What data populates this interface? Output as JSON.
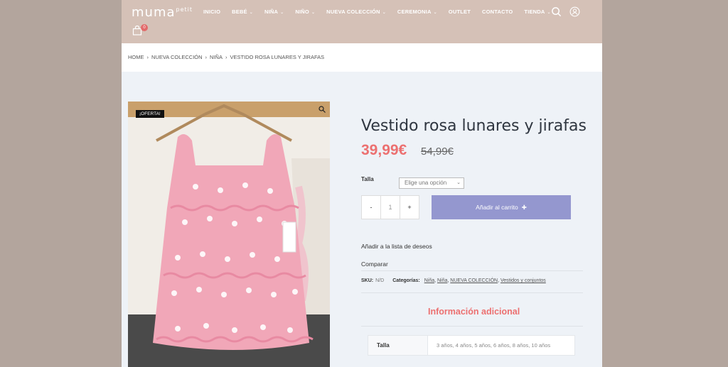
{
  "header": {
    "logo_main": "muma",
    "logo_small": "petit",
    "nav": [
      {
        "label": "INICIO",
        "caret": false
      },
      {
        "label": "BEBÉ",
        "caret": true
      },
      {
        "label": "NIÑA",
        "caret": true
      },
      {
        "label": "NIÑO",
        "caret": true
      },
      {
        "label": "NUEVA COLECCIÓN",
        "caret": true
      },
      {
        "label": "CEREMONIA",
        "caret": true
      },
      {
        "label": "OUTLET",
        "caret": false
      },
      {
        "label": "CONTACTO",
        "caret": false
      },
      {
        "label": "TIENDA",
        "caret": true
      }
    ],
    "cart_count": "0"
  },
  "breadcrumb": [
    "HOME",
    "NUEVA COLECCIÓN",
    "NIÑA",
    "VESTIDO ROSA LUNARES Y JIRAFAS"
  ],
  "product": {
    "badge": "¡OFERTA!",
    "title": "Vestido rosa lunares y jirafas",
    "price_now": "39,99€",
    "price_old": "54,99€",
    "talla_label": "Talla",
    "talla_placeholder": "Elige una opción",
    "qty_minus": "-",
    "qty_value": "1",
    "qty_plus": "+",
    "add_to_cart": "Añadir al carrito",
    "wishlist": "Añadir a la lista de deseos",
    "compare": "Comparar",
    "sku_label": "SKU:",
    "sku_value": "N/D",
    "categories_label": "Categorías:",
    "categories": [
      "Niña",
      "Niña",
      "NUEVA COLECCIÓN",
      "Vestidos y conjuntos"
    ],
    "info_title": "Información adicional",
    "attr_key": "Talla",
    "attr_value": "3 años, 4 años, 5 años, 6 años, 8 años, 10 años"
  },
  "colors": {
    "header": "#d5c1b7",
    "accent": "#ec7070",
    "button": "#9497cf"
  }
}
